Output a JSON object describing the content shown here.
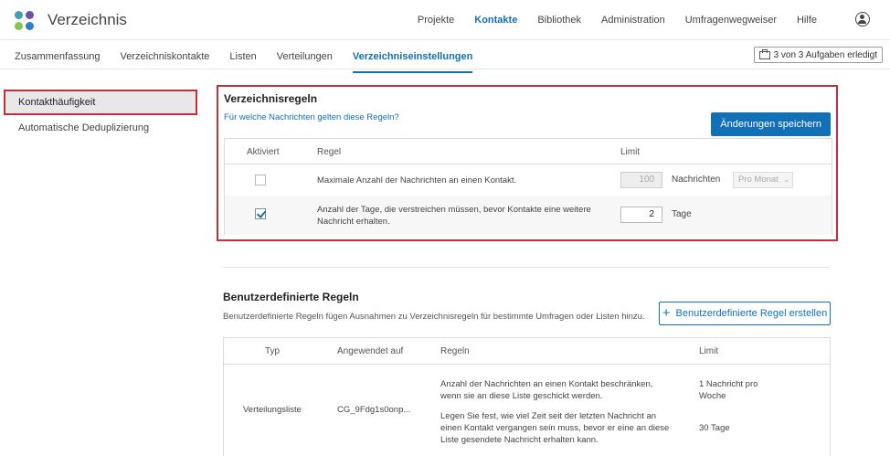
{
  "header": {
    "app_title": "Verzeichnis",
    "nav": [
      "Projekte",
      "Kontakte",
      "Bibliothek",
      "Administration",
      "Umfragenwegweiser",
      "Hilfe"
    ],
    "active_nav": "Kontakte"
  },
  "subnav": {
    "tabs": [
      "Zusammenfassung",
      "Verzeichniskontakte",
      "Listen",
      "Verteilungen",
      "Verzeichniseinstellungen"
    ],
    "tasks_label": "3 von 3 Aufgaben erledigt"
  },
  "sidebar": {
    "items": [
      "Kontakthäufigkeit",
      "Automatische Deduplizierung"
    ]
  },
  "directory_rules": {
    "title": "Verzeichnisregeln",
    "link": "Für welche Nachrichten gelten diese Regeln?",
    "save_label": "Änderungen speichern",
    "columns": [
      "Aktiviert",
      "Regel",
      "Limit"
    ],
    "rows": [
      {
        "enabled": false,
        "rule": "Maximale Anzahl der Nachrichten an einen Kontakt.",
        "value": "100",
        "unit": "Nachrichten",
        "period": "Pro Monat"
      },
      {
        "enabled": true,
        "rule_line1": "Anzahl der Tage, die verstreichen müssen, bevor Kontakte eine weitere",
        "rule_line2": "Nachricht erhalten.",
        "value": "2",
        "unit": "Tage"
      }
    ]
  },
  "custom_rules": {
    "title": "Benutzerdefinierte Regeln",
    "description": "Benutzerdefinierte Regeln fügen Ausnahmen zu Verzeichnisregeln für bestimmte Umfragen oder Listen hinzu.",
    "create_label": "Benutzerdefinierte Regel erstellen",
    "columns": [
      "Typ",
      "Angewendet auf",
      "Regeln",
      "Limit"
    ],
    "row": {
      "type": "Verteilungsliste",
      "applied_to": "CG_9Fdg1s0onp...",
      "rule1_line1": "Anzahl der Nachrichten an einen Kontakt beschränken,",
      "rule1_line2": "wenn sie an diese Liste geschickt werden.",
      "rule2_line1": "Legen Sie fest, wie viel Zeit seit der letzten Nachricht an",
      "rule2_line2": "einen Kontakt vergangen sein muss, bevor er eine an diese",
      "rule2_line3": "Liste gesendete Nachricht erhalten kann.",
      "limit1_line1": "1 Nachricht pro",
      "limit1_line2": "Woche",
      "limit2": "30 Tage"
    }
  },
  "colors": {
    "accent": "#1270b8",
    "highlight_border": "#c0303b"
  }
}
